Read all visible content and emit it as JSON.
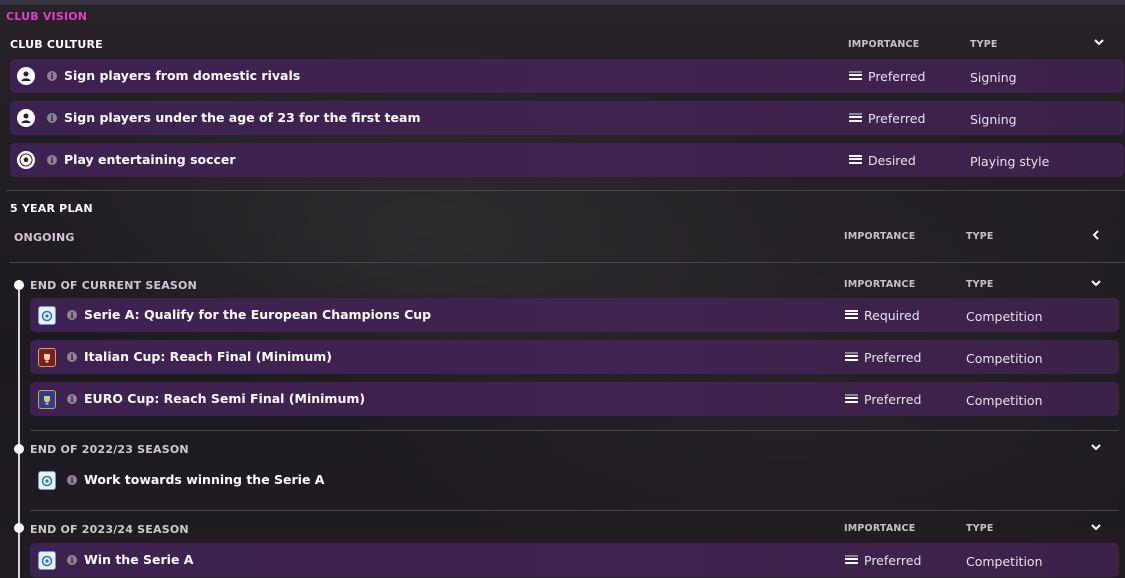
{
  "header": {
    "title": "CLUB VISION"
  },
  "club_culture": {
    "title": "CLUB CULTURE",
    "importance_head": "IMPORTANCE",
    "type_head": "TYPE",
    "items": [
      {
        "icon": "person-icon",
        "label": "Sign players from domestic rivals",
        "importance": "Preferred",
        "type": "Signing"
      },
      {
        "icon": "person-icon",
        "label": "Sign players under the age of 23 for the first team",
        "importance": "Preferred",
        "type": "Signing"
      },
      {
        "icon": "soccer-ball-icon",
        "label": "Play entertaining soccer",
        "importance": "Desired",
        "type": "Playing style"
      }
    ]
  },
  "five_year_plan": {
    "title": "5 YEAR PLAN",
    "ongoing": {
      "title": "ONGOING",
      "importance_head": "IMPORTANCE",
      "type_head": "TYPE"
    },
    "current_season": {
      "title": "END OF CURRENT SEASON",
      "importance_head": "IMPORTANCE",
      "type_head": "TYPE",
      "items": [
        {
          "icon": "serie-a-icon",
          "label": "Serie A: Qualify for the European Champions Cup",
          "importance": "Required",
          "type": "Competition"
        },
        {
          "icon": "italian-cup-icon",
          "label": "Italian Cup: Reach Final (Minimum)",
          "importance": "Preferred",
          "type": "Competition"
        },
        {
          "icon": "euro-cup-icon",
          "label": "EURO Cup: Reach Semi Final (Minimum)",
          "importance": "Preferred",
          "type": "Competition"
        }
      ]
    },
    "season_2223": {
      "title": "END OF 2022/23 SEASON",
      "items": [
        {
          "icon": "serie-a-icon",
          "label": "Work towards winning the Serie A"
        }
      ]
    },
    "season_2324": {
      "title": "END OF 2023/24 SEASON",
      "importance_head": "IMPORTANCE",
      "type_head": "TYPE",
      "items": [
        {
          "icon": "serie-a-icon",
          "label": "Win the Serie A",
          "importance": "Preferred",
          "type": "Competition"
        }
      ]
    }
  }
}
